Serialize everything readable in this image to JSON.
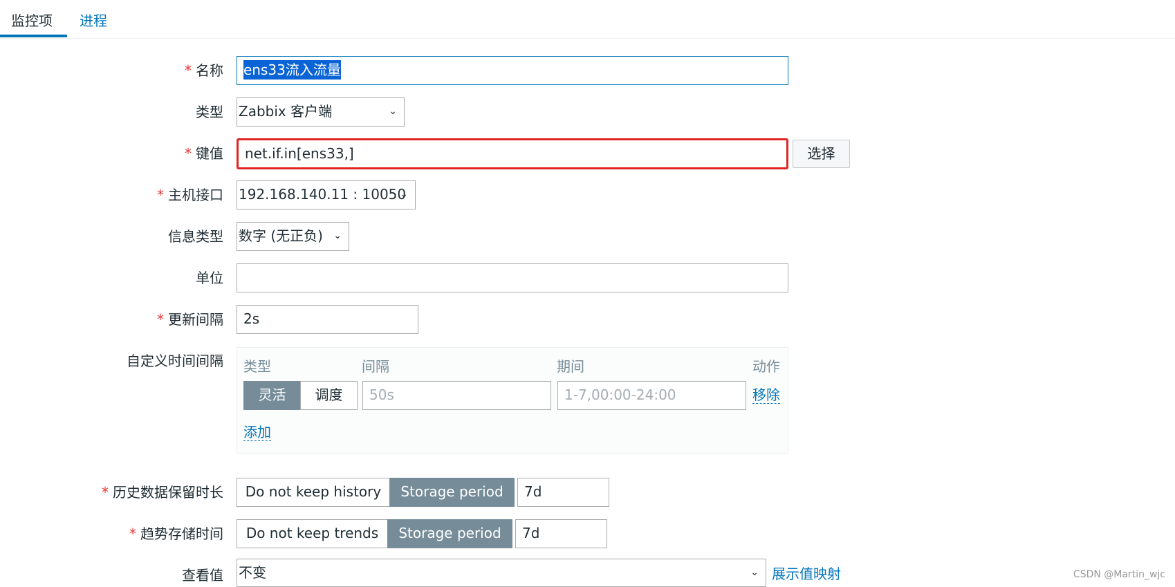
{
  "tabs": {
    "active": "监控项",
    "second": "进程"
  },
  "form": {
    "name": {
      "label": "名称",
      "value": "ens33流入流量"
    },
    "type": {
      "label": "类型",
      "value": "Zabbix 客户端"
    },
    "key": {
      "label": "键值",
      "value": "net.if.in[ens33,]",
      "select_label": "选择"
    },
    "host_interface": {
      "label": "主机接口",
      "value": "192.168.140.11 : 10050"
    },
    "info_type": {
      "label": "信息类型",
      "value": "数字 (无正负)"
    },
    "units": {
      "label": "单位",
      "value": ""
    },
    "update_interval": {
      "label": "更新间隔",
      "value": "2s"
    },
    "custom_intervals": {
      "label": "自定义时间间隔",
      "headers": {
        "type": "类型",
        "interval": "间隔",
        "period": "期间",
        "action": "动作"
      },
      "type_options": {
        "flexible": "灵活",
        "scheduling": "调度"
      },
      "interval_placeholder": "50s",
      "period_placeholder": "1-7,00:00-24:00",
      "remove_label": "移除",
      "add_label": "添加"
    },
    "history": {
      "label": "历史数据保留时长",
      "option_off": "Do not keep history",
      "option_on": "Storage period",
      "value": "7d"
    },
    "trends": {
      "label": "趋势存储时间",
      "option_off": "Do not keep trends",
      "option_on": "Storage period",
      "value": "7d"
    },
    "value_map": {
      "label": "查看值",
      "value": "不变",
      "link": "展示值映射"
    }
  },
  "watermark": "CSDN @Martin_wjc",
  "colors": {
    "accent": "#0275b8",
    "required": "#e33734",
    "segment_active": "#768d99",
    "highlight_border": "#e02424",
    "selection": "#0a64d6"
  }
}
